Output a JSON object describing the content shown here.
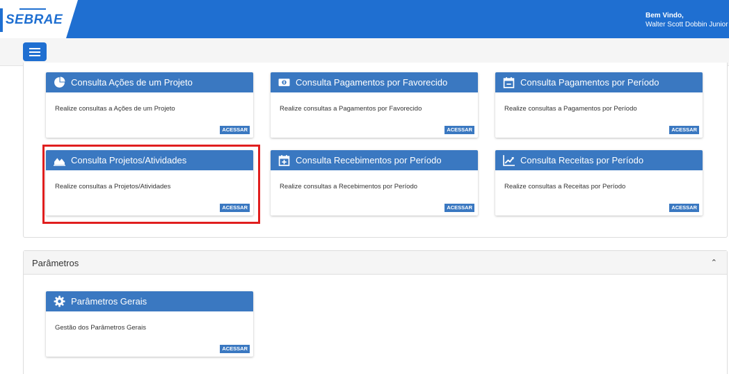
{
  "header": {
    "brand": "SEBRAE",
    "welcome_line1": "Bem Vindo,",
    "welcome_line2": "Walter Scott Dobbin Junior"
  },
  "consultas": {
    "button_label": "ACESSAR",
    "cards": [
      {
        "icon": "pie-chart-icon",
        "title": "Consulta Ações de um Projeto",
        "desc": "Realize consultas a Ações de um Projeto"
      },
      {
        "icon": "money-bill-icon",
        "title": "Consulta Pagamentos por Favorecido",
        "desc": "Realize consultas a Pagamentos por Favorecido"
      },
      {
        "icon": "calendar-minus-icon",
        "title": "Consulta Pagamentos por Período",
        "desc": "Realize consultas a Pagamentos por Período"
      },
      {
        "icon": "area-chart-icon",
        "title": "Consulta Projetos/Atividades",
        "desc": "Realize consultas a Projetos/Atividades"
      },
      {
        "icon": "calendar-plus-icon",
        "title": "Consulta Recebimentos por Período",
        "desc": "Realize consultas a Recebimentos por Período"
      },
      {
        "icon": "line-chart-icon",
        "title": "Consulta Receitas por Período",
        "desc": "Realize consultas a Receitas por Período"
      }
    ]
  },
  "parametros": {
    "section_title": "Parâmetros",
    "button_label": "ACESSAR",
    "cards": [
      {
        "icon": "gear-icon",
        "title": "Parâmetros Gerais",
        "desc": "Gestão dos Parâmetros Gerais"
      }
    ]
  },
  "colors": {
    "header_blue": "#1f6fd1",
    "card_blue": "#3a78c1",
    "highlight_red": "#e01e1e"
  }
}
